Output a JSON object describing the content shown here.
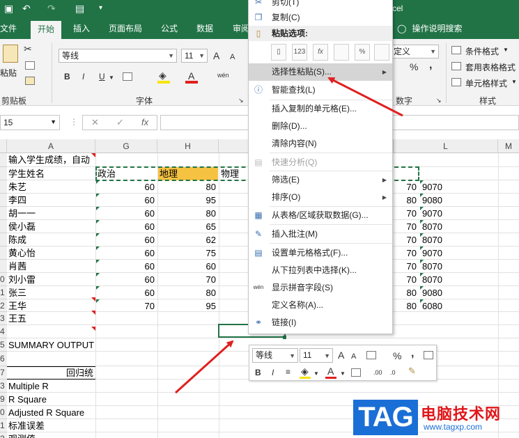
{
  "title_bar": {
    "title_fragment": "cel",
    "quick_access": [
      "save-icon",
      "undo-icon",
      "redo-icon",
      "print-preview-icon",
      "customize-icon"
    ]
  },
  "ribbon_tabs": [
    {
      "label": "文件"
    },
    {
      "label": "开始"
    },
    {
      "label": "插入"
    },
    {
      "label": "页面布局"
    },
    {
      "label": "公式"
    },
    {
      "label": "数据"
    },
    {
      "label": "审阅"
    }
  ],
  "tell_me": "操作说明搜索",
  "ribbon": {
    "clipboard": {
      "paste_label": "粘贴",
      "group_label": "剪贴板"
    },
    "font": {
      "font_name": "等线",
      "font_size": "11",
      "group_label": "字体",
      "grow": "A",
      "shrink": "A",
      "bold": "B",
      "italic": "I",
      "underline": "U",
      "font_color": "A",
      "phonetic": "wén"
    },
    "number": {
      "format": "定义",
      "percent": "%",
      "comma": ",",
      "group_label": "数字"
    },
    "styles": {
      "conditional": "条件格式",
      "table": "套用表格格式",
      "cell_styles": "单元格样式",
      "group_label": "样式"
    }
  },
  "formula_bar": {
    "name_box": "15",
    "cancel": "✕",
    "enter": "✓",
    "fx": "fx",
    "value": ""
  },
  "columns": [
    "A",
    "G",
    "H",
    "",
    "",
    "",
    "",
    "L",
    "M"
  ],
  "rows": [
    {
      "num": "",
      "a": "输入学生成绩，自动",
      "g": "",
      "h": "",
      "l": ""
    },
    {
      "num": "",
      "a": "学生姓名",
      "g": "政治",
      "h": "地理",
      "i": "物理",
      "l": ""
    },
    {
      "num": "",
      "a": "朱艺",
      "g": "60",
      "h": "80",
      "k": "70",
      "l": "9070"
    },
    {
      "num": "",
      "a": "李四",
      "g": "60",
      "h": "95",
      "k": "80",
      "l": "9080"
    },
    {
      "num": "",
      "a": "胡一一",
      "g": "60",
      "h": "80",
      "k": "70",
      "l": "9070"
    },
    {
      "num": "",
      "a": "侯小磊",
      "g": "60",
      "h": "65",
      "k": "70",
      "l": "8070"
    },
    {
      "num": "",
      "a": "陈成",
      "g": "60",
      "h": "62",
      "k": "70",
      "l": "8070"
    },
    {
      "num": "",
      "a": "黄心怡",
      "g": "60",
      "h": "75",
      "k": "70",
      "l": "9070"
    },
    {
      "num": "",
      "a": "肖茜",
      "g": "60",
      "h": "60",
      "k": "70",
      "l": "8070"
    },
    {
      "num": "0",
      "a": "刘小雷",
      "g": "60",
      "h": "70",
      "k": "70",
      "l": "8070"
    },
    {
      "num": "1",
      "a": "张三",
      "g": "60",
      "h": "80",
      "k": "80",
      "l": "9080"
    },
    {
      "num": "2",
      "a": "王华",
      "g": "70",
      "h": "95",
      "k": "80",
      "l": "6080"
    },
    {
      "num": "3",
      "a": "王五",
      "g": "",
      "h": "",
      "l": ""
    },
    {
      "num": "4",
      "a": "",
      "g": "",
      "h": "",
      "l": ""
    },
    {
      "num": "5",
      "a": "SUMMARY OUTPUT",
      "g": "",
      "h": "",
      "l": ""
    },
    {
      "num": "6",
      "a": "",
      "g": "",
      "h": "",
      "l": ""
    },
    {
      "num": "7",
      "a": "回归统",
      "g": "",
      "h": "",
      "l": ""
    },
    {
      "num": "3",
      "a": "Multiple R",
      "g": "",
      "h": "",
      "l": ""
    },
    {
      "num": "9",
      "a": "R Square",
      "g": "",
      "h": "",
      "l": ""
    },
    {
      "num": "0",
      "a": "Adjusted R Square",
      "g": "",
      "h": "",
      "l": ""
    },
    {
      "num": "1",
      "a": "标准误差",
      "g": "",
      "h": "",
      "l": ""
    },
    {
      "num": "2",
      "a": "观测值",
      "g": "",
      "h": "",
      "l": ""
    }
  ],
  "context_menu": {
    "cut": "剪切(T)",
    "copy": "复制(C)",
    "paste_options": "粘贴选项:",
    "paste_icons": [
      "123",
      "fx",
      "",
      "%",
      ""
    ],
    "items": [
      {
        "label": "选择性粘贴(S)...",
        "submenu": true,
        "disabled": false
      },
      {
        "label": "智能查找(L)",
        "submenu": false,
        "disabled": false
      },
      {
        "label": "插入复制的单元格(E)...",
        "submenu": false,
        "disabled": false
      },
      {
        "label": "删除(D)...",
        "submenu": false,
        "disabled": false
      },
      {
        "label": "清除内容(N)",
        "submenu": false,
        "disabled": false
      },
      {
        "label": "快速分析(Q)",
        "submenu": false,
        "disabled": true
      },
      {
        "label": "筛选(E)",
        "submenu": true,
        "disabled": false
      },
      {
        "label": "排序(O)",
        "submenu": true,
        "disabled": false
      },
      {
        "label": "从表格/区域获取数据(G)...",
        "submenu": false,
        "disabled": false
      },
      {
        "label": "插入批注(M)",
        "submenu": false,
        "disabled": false
      },
      {
        "label": "设置单元格格式(F)...",
        "submenu": false,
        "disabled": false
      },
      {
        "label": "从下拉列表中选择(K)...",
        "submenu": false,
        "disabled": false
      },
      {
        "label": "显示拼音字段(S)",
        "submenu": false,
        "disabled": false
      },
      {
        "label": "定义名称(A)...",
        "submenu": false,
        "disabled": false
      },
      {
        "label": "链接(I)",
        "submenu": false,
        "disabled": false
      }
    ]
  },
  "mini_toolbar": {
    "font_name": "等线",
    "font_size": "11",
    "percent": "%",
    "comma": ",",
    "bold": "B",
    "italic": "I",
    "font_color": "A"
  },
  "watermark": {
    "logo": "TAG",
    "title": "电脑技术网",
    "url": "www.tagxp.com"
  },
  "colors": {
    "excel_green": "#217346",
    "highlight_yellow": "#f5c242",
    "arrow_red": "#e02020",
    "watermark_blue": "#1a6fd6",
    "watermark_red": "#e0161a"
  }
}
